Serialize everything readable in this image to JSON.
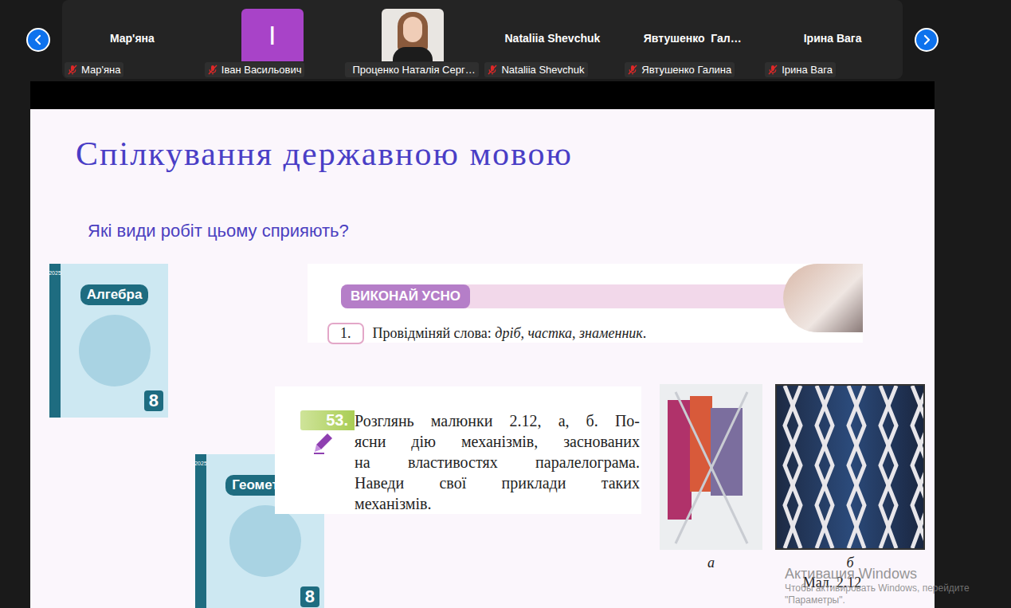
{
  "participants": [
    {
      "kind": "name",
      "name": "Мар'яна",
      "label": "Мар'яна",
      "muted": true
    },
    {
      "kind": "avatar",
      "avatar": "І",
      "label": "Іван Васильович",
      "muted": true
    },
    {
      "kind": "photo",
      "label": "Проценко Наталія Серг…",
      "muted": true
    },
    {
      "kind": "name",
      "name": "Nataliia Shevchuk",
      "label": "Nataliia Shevchuk",
      "muted": true
    },
    {
      "kind": "name",
      "name": "Явтушенко  Гал…",
      "label": "Явтушенко Галина",
      "muted": true
    },
    {
      "kind": "name",
      "name": "Ірина Вага",
      "label": "Ірина Вага",
      "muted": true
    }
  ],
  "slide": {
    "title": "Спілкування державною мовою",
    "subtitle": "Які види робіт цьому сприяють?",
    "books": [
      {
        "title": "Алгебра",
        "grade": "8",
        "year": "2025"
      },
      {
        "title": "Геометрія",
        "grade": "8",
        "year": "2025"
      }
    ],
    "task_oral": {
      "banner": "ВИКОНАЙ УСНО",
      "number": "1.",
      "segments": [
        {
          "text": "Провідміняй слова: ",
          "italic": false
        },
        {
          "text": "дріб",
          "italic": true
        },
        {
          "text": ", ",
          "italic": false
        },
        {
          "text": "частка",
          "italic": true
        },
        {
          "text": ", ",
          "italic": false
        },
        {
          "text": "знаменник",
          "italic": true
        },
        {
          "text": ".",
          "italic": false
        }
      ]
    },
    "task_53": {
      "number": "53.",
      "lines": [
        "Розглянь малюнки 2.12, а, б. По-",
        "ясни дію механізмів, заснованих",
        "на властивостях паралелограма.",
        "Наведи свої приклади таких",
        "механізмів."
      ]
    },
    "figure": {
      "labels": [
        "а",
        "б"
      ],
      "caption": "Мал. 2.12"
    }
  },
  "watermark": {
    "title": "Активация Windows",
    "lines": [
      "Чтобы активировать Windows, перейдите",
      "\"Параметры\"."
    ]
  }
}
